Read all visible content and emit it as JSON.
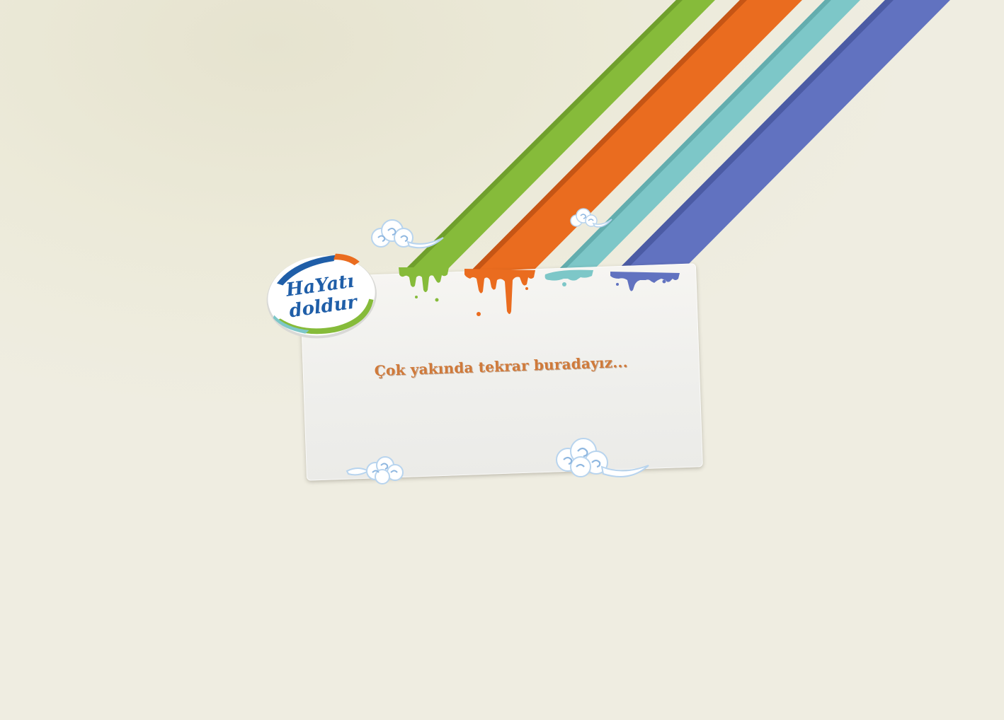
{
  "logo": {
    "text_line1": "HaYatı",
    "text_line2": "doldur"
  },
  "message": "Çok yakında tekrar buradayız...",
  "colors": {
    "green": "#86bb3a",
    "orange": "#ea6c1f",
    "teal": "#7dc7c8",
    "blue": "#6172c0",
    "message_text": "#d07a3a",
    "logo_blue": "#1f5ea8"
  },
  "decor": {
    "stripes": [
      "green-stripe",
      "orange-stripe",
      "teal-stripe",
      "blue-stripe"
    ],
    "clouds": [
      "cloud-icon",
      "cloud-icon",
      "cloud-icon",
      "cloud-icon"
    ]
  }
}
